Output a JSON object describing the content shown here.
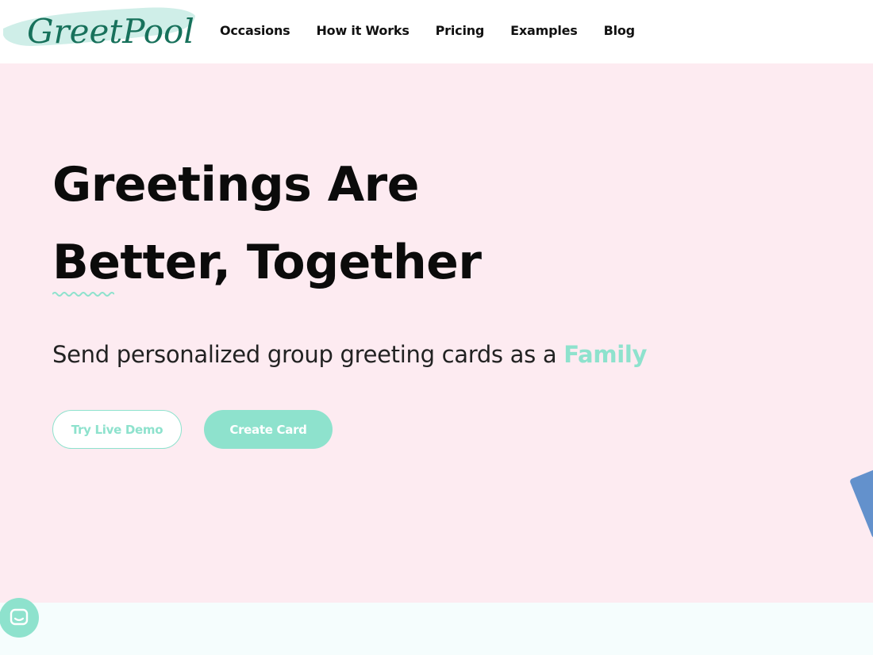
{
  "brand": {
    "name": "GreetPool"
  },
  "nav": {
    "items": [
      {
        "label": "Occasions"
      },
      {
        "label": "How it Works"
      },
      {
        "label": "Pricing"
      },
      {
        "label": "Examples"
      },
      {
        "label": "Blog"
      }
    ]
  },
  "hero": {
    "title_line1": "Greetings Are",
    "title_line2": "Better, Together",
    "subtitle_prefix": "Send personalized group greeting cards as a ",
    "subtitle_accent": "Family",
    "buttons": {
      "demo": "Try Live Demo",
      "create": "Create Card"
    }
  },
  "colors": {
    "accent": "#8ee2cd",
    "hero_bg": "#fdebf1",
    "logo_text": "#17715b",
    "widget": "#6391cc"
  },
  "icons": {
    "chat": "chat-bubble-icon",
    "decoration": "squiggle-underline",
    "side_widget": "feedback-tab-icon"
  }
}
